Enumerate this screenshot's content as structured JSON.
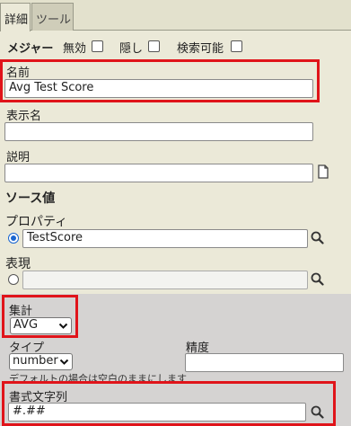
{
  "tabs": [
    {
      "label": "詳細",
      "active": true
    },
    {
      "label": "ツール",
      "active": false
    }
  ],
  "flags": {
    "measure_label": "メジャー",
    "disabled_label": "無効",
    "hidden_label": "隠し",
    "searchable_label": "検索可能"
  },
  "name": {
    "label": "名前",
    "value": "Avg Test Score"
  },
  "display_name": {
    "label": "表示名",
    "value": ""
  },
  "description": {
    "label": "説明",
    "value": ""
  },
  "source_value": {
    "label": "ソース値",
    "property_label": "プロパティ",
    "property_value": "TestScore",
    "expression_label": "表現",
    "expression_value": ""
  },
  "aggregation": {
    "label": "集計",
    "selected": "AVG"
  },
  "type": {
    "label": "タイプ",
    "selected": "number",
    "hint": "デフォルトの場合は空白のままにします"
  },
  "precision": {
    "label": "精度",
    "value": ""
  },
  "format_string": {
    "label": "書式文字列",
    "value": "#.##"
  },
  "colors": {
    "highlight": "#e0141a",
    "radio_accent": "#1a66d0",
    "background": "#ebe9d8",
    "lower_band": "#d5d3d2"
  }
}
